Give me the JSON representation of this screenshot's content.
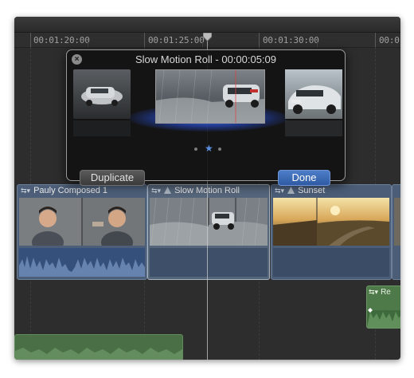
{
  "ruler": {
    "ticks": [
      "00:01:20:00",
      "00:01:25:00",
      "00:01:30:00",
      "00:0"
    ]
  },
  "popover": {
    "title": "Slow Motion Roll - 00:00:05:09",
    "close_icon": "close-icon",
    "duplicate_label": "Duplicate",
    "done_label": "Done"
  },
  "clips": [
    {
      "name": "Pauly Composed 1"
    },
    {
      "name": "Slow Motion Roll"
    },
    {
      "name": "Sunset"
    },
    {
      "name": ""
    }
  ],
  "connected_clip": {
    "name": "Re"
  },
  "colors": {
    "accent_blue": "#2d5aa3",
    "clip_blue": "#4d5f78",
    "audio_green": "#4e7a4a",
    "glow_blue": "#4678ff"
  }
}
